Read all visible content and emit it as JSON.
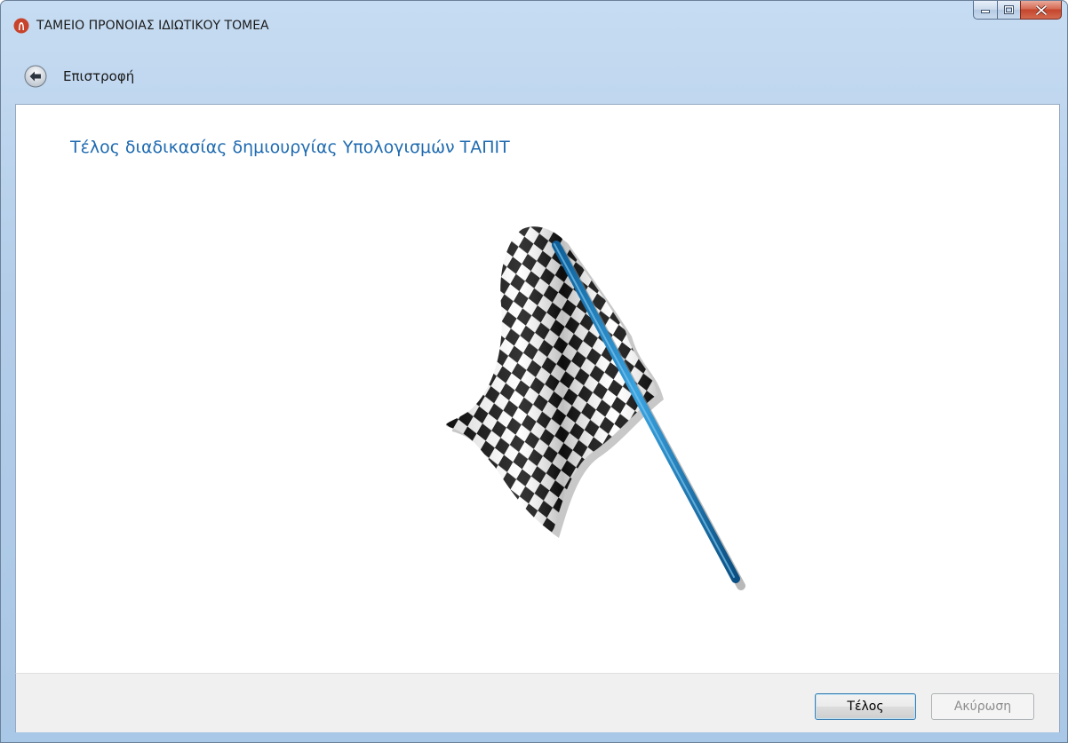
{
  "window": {
    "title": "ΤΑΜΕΙΟ ΠΡΟΝΟΙΑΣ ΙΔΙΩΤΙΚΟΥ ΤΟΜΕΑ",
    "app_icon": "app-logo-icon",
    "caption_buttons": [
      "minimize-icon",
      "maximize-icon",
      "close-icon"
    ]
  },
  "nav": {
    "back_label": "Επιστροφή",
    "back_icon": "arrow-left-icon"
  },
  "main": {
    "heading": "Τέλος διαδικασίας δημιουργίας Υπολογισμών ΤΑΠΙΤ",
    "illustration": "checkered-flag-icon"
  },
  "footer": {
    "finish_label": "Τέλος",
    "cancel_label": "Ακύρωση",
    "cancel_enabled": false
  },
  "colors": {
    "heading": "#1f6bb0",
    "flag_pole": "#1b7fc4",
    "close_button": "#c4452c"
  }
}
